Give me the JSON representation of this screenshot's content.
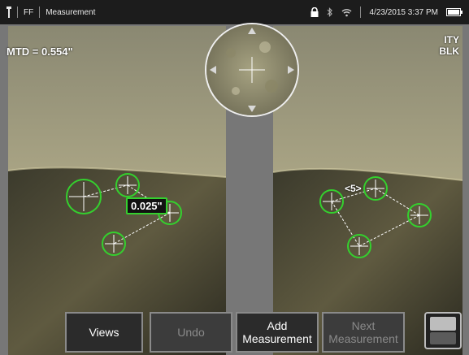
{
  "status": {
    "freeze_mode": "FF",
    "screen_title": "Measurement",
    "datetime": "4/23/2015 3:37 PM",
    "icons": [
      "probe-icon",
      "lock-icon",
      "bluetooth-icon",
      "wifi-icon",
      "battery-icon"
    ]
  },
  "left_view": {
    "mtd": "MTD = 0.554\"",
    "measurement_value": "0.025\""
  },
  "right_view": {
    "cursor_label": "<5>",
    "tag_line1": "ITY",
    "tag_line2": "BLK"
  },
  "toolbar": {
    "views": "Views",
    "undo": "Undo",
    "add_line1": "Add",
    "add_line2": "Measurement",
    "next_line1": "Next",
    "next_line2": "Measurement"
  },
  "colors": {
    "cursor_green": "#34d02e",
    "statusbar": "#1c1c1c"
  }
}
